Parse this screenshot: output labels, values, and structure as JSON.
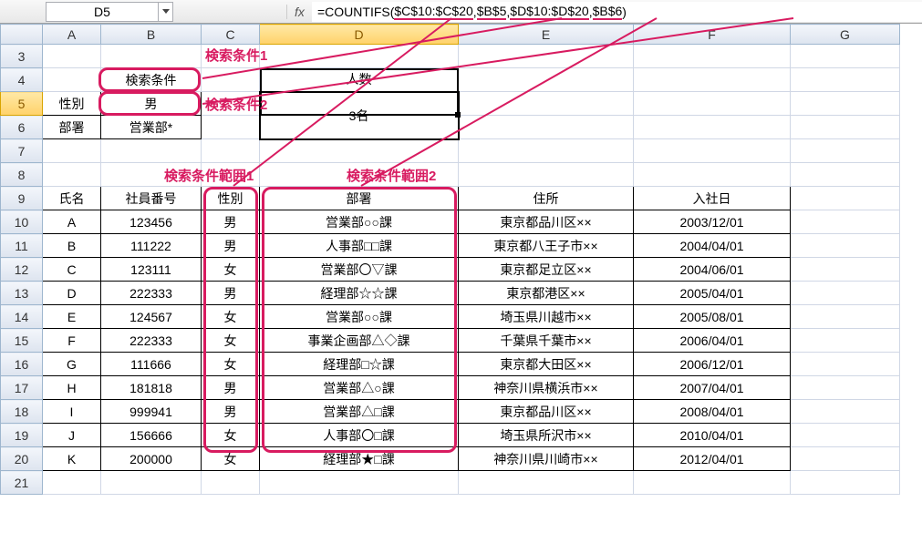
{
  "formula_bar": {
    "name_box": "D5",
    "fx": "fx",
    "formula_parts": [
      {
        "t": "=COUNTIFS(",
        "u": false
      },
      {
        "t": "$C$10:$C$20",
        "u": true
      },
      {
        "t": ",",
        "u": false
      },
      {
        "t": "$B$5",
        "u": true
      },
      {
        "t": ",",
        "u": false
      },
      {
        "t": "$D$10:$D$20",
        "u": true
      },
      {
        "t": ",",
        "u": false
      },
      {
        "t": "$B$6",
        "u": true
      },
      {
        "t": ")",
        "u": false
      }
    ]
  },
  "columns": [
    "A",
    "B",
    "C",
    "D",
    "E",
    "F",
    "G"
  ],
  "rows": [
    "3",
    "4",
    "5",
    "6",
    "7",
    "8",
    "9",
    "10",
    "11",
    "12",
    "13",
    "14",
    "15",
    "16",
    "17",
    "18",
    "19",
    "20",
    "21"
  ],
  "active": {
    "col": "D",
    "row": "5"
  },
  "cells": {
    "B4": "検索条件",
    "D4": "人数",
    "A5": "性別",
    "B5": "男",
    "A6": "部署",
    "B6": "営業部*",
    "D5": "3名",
    "A9": "氏名",
    "B9": "社員番号",
    "C9": "性別",
    "D9": "部署",
    "E9": "住所",
    "F9": "入社日"
  },
  "table_rows": [
    {
      "row": "10",
      "name": "A",
      "empno": "123456",
      "gender": "男",
      "dept": "営業部○○課",
      "addr": "東京都品川区××",
      "hire": "2003/12/01"
    },
    {
      "row": "11",
      "name": "B",
      "empno": "111222",
      "gender": "男",
      "dept": "人事部□□課",
      "addr": "東京都八王子市××",
      "hire": "2004/04/01"
    },
    {
      "row": "12",
      "name": "C",
      "empno": "123111",
      "gender": "女",
      "dept": "営業部〇▽課",
      "addr": "東京都足立区××",
      "hire": "2004/06/01"
    },
    {
      "row": "13",
      "name": "D",
      "empno": "222333",
      "gender": "男",
      "dept": "経理部☆☆課",
      "addr": "東京都港区××",
      "hire": "2005/04/01"
    },
    {
      "row": "14",
      "name": "E",
      "empno": "124567",
      "gender": "女",
      "dept": "営業部○○課",
      "addr": "埼玉県川越市××",
      "hire": "2005/08/01"
    },
    {
      "row": "15",
      "name": "F",
      "empno": "222333",
      "gender": "女",
      "dept": "事業企画部△◇課",
      "addr": "千葉県千葉市××",
      "hire": "2006/04/01"
    },
    {
      "row": "16",
      "name": "G",
      "empno": "111666",
      "gender": "女",
      "dept": "経理部□☆課",
      "addr": "東京都大田区××",
      "hire": "2006/12/01"
    },
    {
      "row": "17",
      "name": "H",
      "empno": "181818",
      "gender": "男",
      "dept": "営業部△○課",
      "addr": "神奈川県横浜市××",
      "hire": "2007/04/01"
    },
    {
      "row": "18",
      "name": "I",
      "empno": "999941",
      "gender": "男",
      "dept": "営業部△□課",
      "addr": "東京都品川区××",
      "hire": "2008/04/01"
    },
    {
      "row": "19",
      "name": "J",
      "empno": "156666",
      "gender": "女",
      "dept": "人事部〇□課",
      "addr": "埼玉県所沢市××",
      "hire": "2010/04/01"
    },
    {
      "row": "20",
      "name": "K",
      "empno": "200000",
      "gender": "女",
      "dept": "経理部★□課",
      "addr": "神奈川県川崎市××",
      "hire": "2012/04/01"
    }
  ],
  "annotations": {
    "cond1": "検索条件1",
    "cond2": "検索条件2",
    "range1": "検索条件範囲1",
    "range2": "検索条件範囲2"
  }
}
